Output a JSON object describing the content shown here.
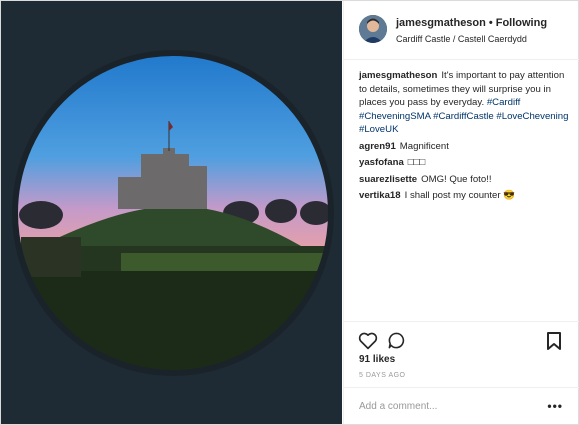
{
  "post": {
    "username": "jamesgmatheson",
    "follow_status": "Following",
    "location": "Cardiff Castle / Castell Caerdydd",
    "photo_alt": "castle-photo"
  },
  "comments": [
    {
      "user": "jamesgmatheson",
      "text": "It's important to pay attention to details, sometimes they will surprise you in places you pass by everyday.",
      "tags": "#Cardiff #CheveningSMA #CardiffCastle #LoveChevening #LoveUK"
    },
    {
      "user": "agren91",
      "text": "Magnificent"
    },
    {
      "user": "yasfofana",
      "text": "□□□"
    },
    {
      "user": "suarezlisette",
      "text": "OMG! Que foto!!"
    },
    {
      "user": "vertika18",
      "text": "I shall post my counter 😎"
    }
  ],
  "actions": {
    "likes": "91 likes",
    "time": "5 DAYS AGO",
    "add_comment_placeholder": "Add a comment...",
    "more": "•••"
  },
  "icons": [
    "heart-icon",
    "comment-icon",
    "bookmark-icon",
    "more-options-icon"
  ]
}
